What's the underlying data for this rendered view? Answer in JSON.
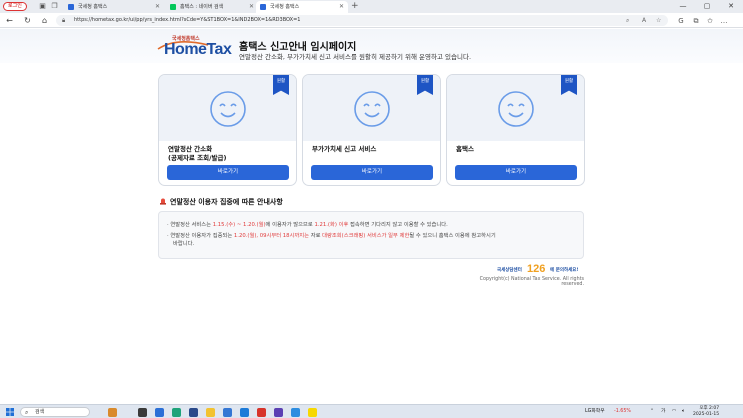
{
  "browser": {
    "profile_label": "로그인",
    "tabs": [
      {
        "label": "국세청 홈택스",
        "favicon_color": "#2a66d8"
      },
      {
        "label": "홈택스 : 네이버 검색",
        "favicon_color": "#03c75a"
      },
      {
        "label": "국세청 홈택스",
        "favicon_color": "#2a66d8"
      }
    ],
    "new_tab": "+",
    "url": "https://hometax.go.kr/ui/pp/yrs_index.html?sCde=Y&ST1BOX=1&IND2BOX=1&RD3BOX=1"
  },
  "header": {
    "logo_sub": "국세청홈택스",
    "logo_main": "HomeTax",
    "title": "홈택스 신고안내 임시페이지",
    "description": "연말정산 간소화, 부가가치세 신고 서비스를 원활히 제공하기 위해 운영하고 있습니다."
  },
  "cards": [
    {
      "label": "연말정산 간소화\n(공제자료 조회/발급)",
      "badge": "원활",
      "button": "바로가기"
    },
    {
      "label": "부가가치세 신고 서비스",
      "badge": "원활",
      "button": "바로가기"
    },
    {
      "label": "홈택스",
      "badge": "원활",
      "button": "바로가기"
    }
  ],
  "notice": {
    "title": "연말정산 이용자 집중에 따른 안내사항",
    "line1": {
      "a": "· 연말정산 서비스는 ",
      "b": "1.15.(수) ~ 1.20.(월)",
      "c": "에 이용자가 많으므로 ",
      "d": "1.21.(화) 이후",
      "e": " 접속하면 기다리지 않고 이용할 수 있습니다."
    },
    "line2": {
      "a": "· 연말정산 이용자가 집중되는 ",
      "b": "1.20.(월), 09시부터 18시까지는",
      "c": " 자료 ",
      "d": "대량조회(스크래핑) 서비스가 일부 제한",
      "e": "될 수 있으니 홈택스 이용에 참고하시기"
    },
    "line3": "바랍니다."
  },
  "footer": {
    "banner_prefix": "국세상담센터",
    "banner_number": "126",
    "banner_suffix": "에 문의하세요!",
    "copyright": "Copyright(c) National Tax Service. All rights reserved."
  },
  "taskbar": {
    "search_label": "검색",
    "stock_label": "LG화학우",
    "stock_change": "-1.65%",
    "time": "오후 2:07",
    "date": "2025-01-15"
  },
  "colors": {
    "accent": "#2a66d8",
    "badge": "#1e55c4",
    "notice_red": "#e03a3a"
  }
}
